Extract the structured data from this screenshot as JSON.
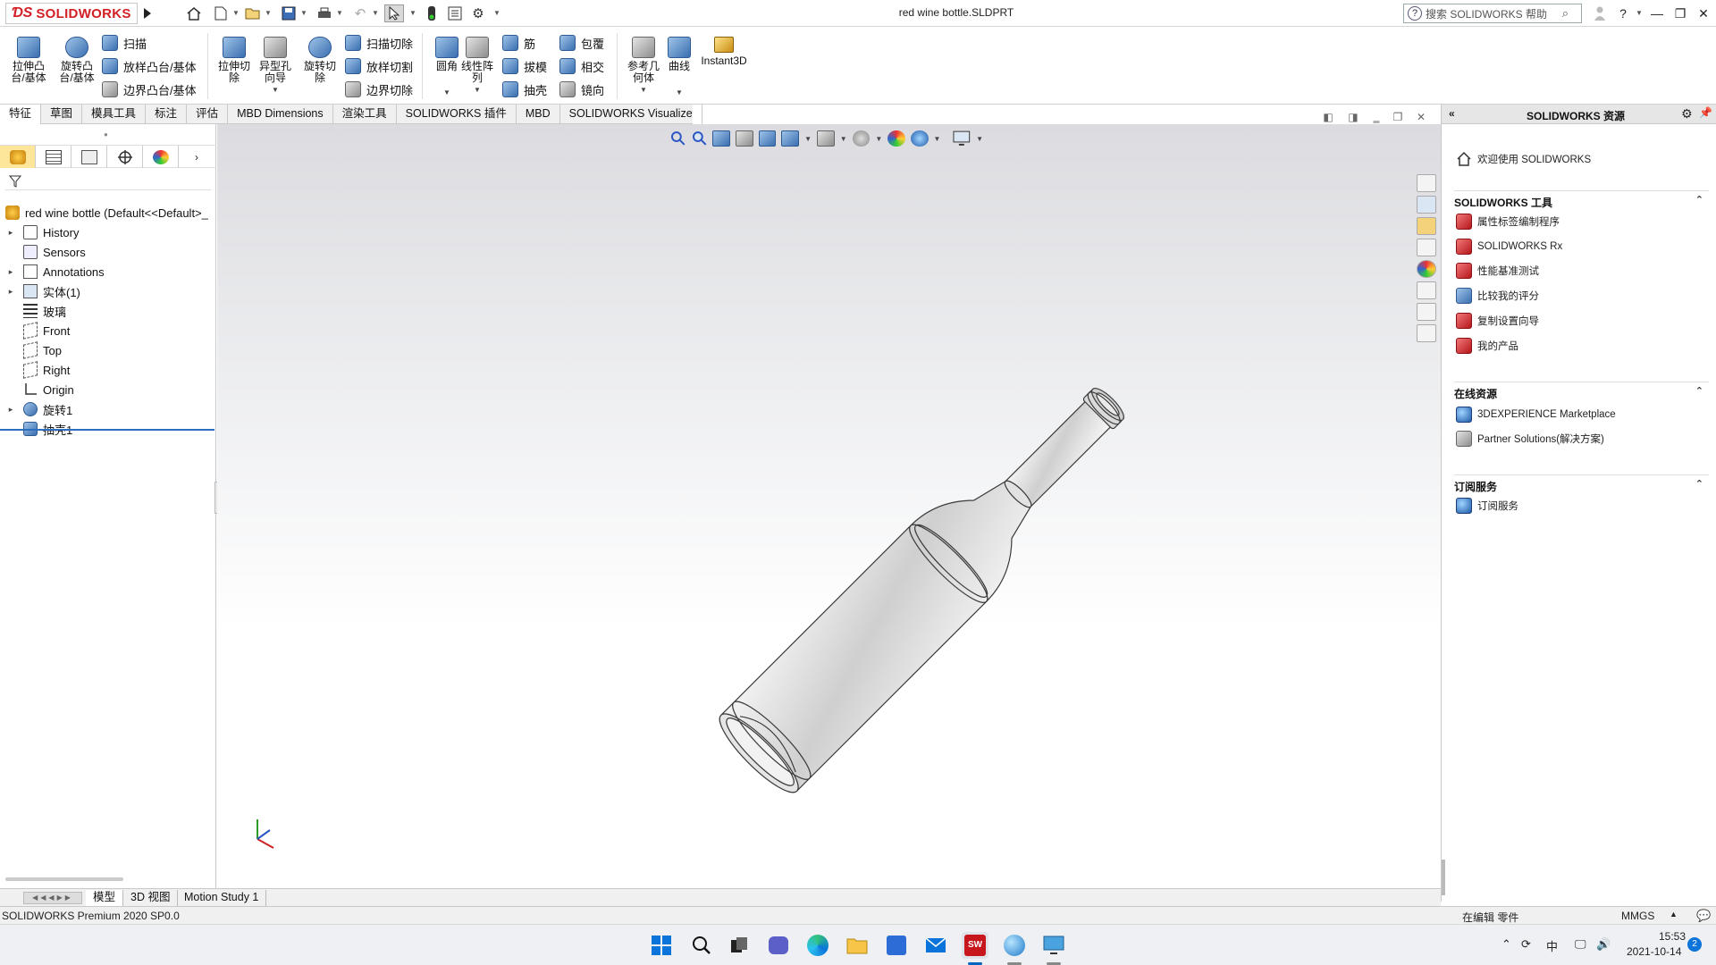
{
  "app": {
    "brand": "SOLIDWORKS",
    "document_title": "red wine bottle.SLDPRT",
    "search_placeholder": "搜索 SOLIDWORKS 帮助"
  },
  "command_manager": {
    "extrude_boss": "拉伸凸台/基体",
    "revolve_boss": "旋转凸台/基体",
    "sweep": "扫描",
    "loft_boss": "放样凸台/基体",
    "boundary_boss": "边界凸台/基体",
    "extrude_cut": "拉伸切除",
    "hole_wizard": "异型孔向导",
    "revolve_cut": "旋转切除",
    "swept_cut": "扫描切除",
    "lofted_cut": "放样切割",
    "boundary_cut": "边界切除",
    "fillet": "圆角",
    "linear_pattern": "线性阵列",
    "rib": "筋",
    "draft": "拔模",
    "shell": "抽壳",
    "wrap": "包覆",
    "intersect": "相交",
    "mirror": "镜向",
    "ref_geometry": "参考几何体",
    "curves": "曲线",
    "instant3d": "Instant3D"
  },
  "tabs": [
    "特征",
    "草图",
    "模具工具",
    "标注",
    "评估",
    "MBD Dimensions",
    "渲染工具",
    "SOLIDWORKS 插件",
    "MBD",
    "SOLIDWORKS Visualize"
  ],
  "feature_tree": {
    "root": "red wine bottle  (Default<<Default>_",
    "items": [
      "History",
      "Sensors",
      "Annotations",
      "实体(1)",
      "玻璃",
      "Front",
      "Top",
      "Right",
      "Origin",
      "旋转1",
      "抽壳1"
    ]
  },
  "task_pane": {
    "title": "SOLIDWORKS 资源",
    "welcome": "欢迎使用  SOLIDWORKS",
    "tools_header": "SOLIDWORKS 工具",
    "tools": [
      "属性标签编制程序",
      "SOLIDWORKS Rx",
      "性能基准测试",
      "比较我的评分",
      "复制设置向导",
      "我的产品"
    ],
    "online_header": "在线资源",
    "online": [
      "3DEXPERIENCE Marketplace",
      "Partner Solutions(解决方案)"
    ],
    "subscription_header": "订阅服务",
    "subscription": [
      "订阅服务"
    ]
  },
  "bottom_tabs": [
    "模型",
    "3D 视图",
    "Motion Study 1"
  ],
  "status": {
    "left": "SOLIDWORKS Premium 2020 SP0.0",
    "editing": "在编辑 零件",
    "units": "MMGS"
  },
  "taskbar": {
    "ime": "中",
    "time": "15:53",
    "date": "2021-10-14",
    "notifications": "2"
  },
  "colors": {
    "accent": "#d21f26",
    "selection": "#2c6fbf",
    "active_tab": "#fde59a"
  }
}
